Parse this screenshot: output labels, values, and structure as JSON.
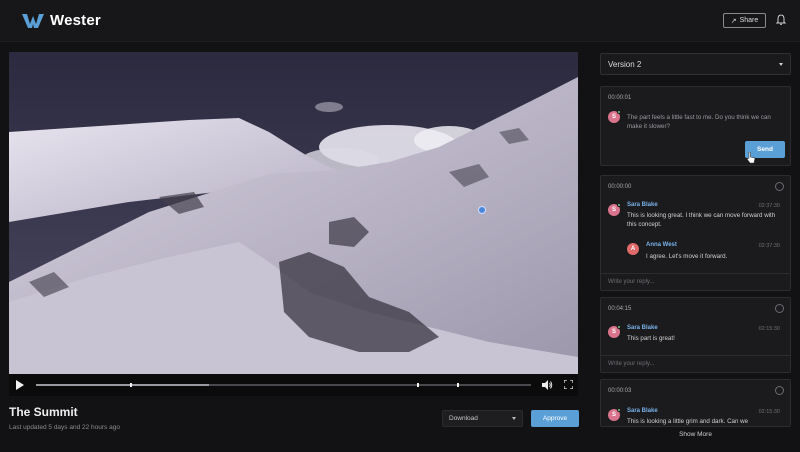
{
  "app": {
    "name": "Wester",
    "brand_color": "#5aa0d6"
  },
  "header": {
    "share_label": "Share",
    "share_icon": "arrow-up-right-icon",
    "bell_icon": "bell-icon"
  },
  "player": {
    "progress": 0.35,
    "markers": [
      0.19,
      0.77,
      0.85
    ],
    "icons": {
      "play": "play-icon",
      "volume": "volume-icon",
      "fullscreen": "fullscreen-icon"
    }
  },
  "video": {
    "title": "The Summit",
    "updated": "Last updated 5 days and 22 hours ago",
    "download_label": "Download",
    "approve_label": "Approve"
  },
  "panel": {
    "version": "Version 2",
    "draft": {
      "timestamp": "00:00:01",
      "avatar_initial": "S",
      "text": "The part feels a little fast to me. Do you think we can make it slower?",
      "send_label": "Send"
    },
    "threads": [
      {
        "timestamp": "00:00:00",
        "comments": [
          {
            "initial": "S",
            "author": "Sara Blake",
            "time": "02:37:30",
            "text": "This is looking great. I think we can move forward with this concept."
          },
          {
            "initial": "A",
            "author": "Anna West",
            "time": "02:37:30",
            "text": "I agree. Let's move it forward."
          }
        ],
        "reply_placeholder": "Write your reply..."
      },
      {
        "timestamp": "00:04:15",
        "comments": [
          {
            "initial": "S",
            "author": "Sara Blake",
            "time": "02:15:30",
            "text": "This part is great!"
          }
        ],
        "reply_placeholder": "Write your reply..."
      },
      {
        "timestamp": "00:00:03",
        "comments": [
          {
            "initial": "S",
            "author": "Sara Blake",
            "time": "02:15:30",
            "text": "This is looking a little grim and dark. Can we"
          }
        ]
      }
    ],
    "show_more_label": "Show More"
  }
}
